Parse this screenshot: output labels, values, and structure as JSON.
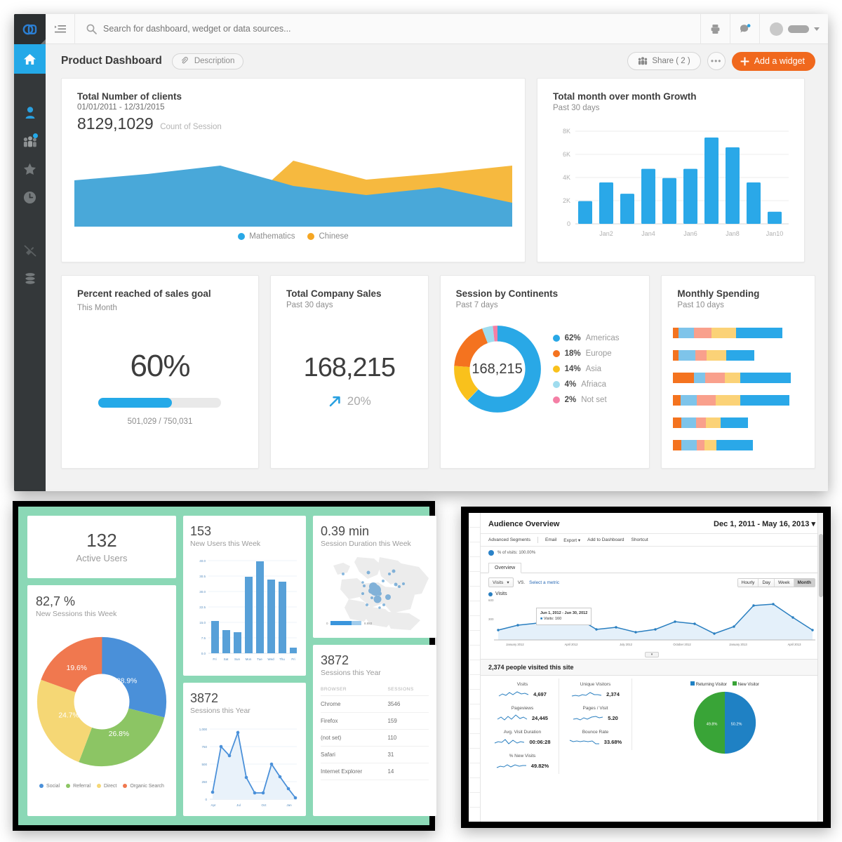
{
  "main_app": {
    "logo_icon": "chain-logo-icon",
    "topbar": {
      "collapse_icon": "collapse-sidebar-icon",
      "search_placeholder": "Search for dashboard, wedget or data sources...",
      "search_value": "",
      "search_icon": "search-icon",
      "print_icon": "print-icon",
      "notifications_icon": "chat-bubble-icon",
      "avatar_icon": "avatar",
      "caret_icon": "chevron-down-icon"
    },
    "sidebar": {
      "items": [
        {
          "name": "home",
          "icon": "home-icon",
          "active": true
        },
        {
          "name": "user",
          "icon": "person-icon",
          "active": false
        },
        {
          "name": "team",
          "icon": "group-icon",
          "active": false,
          "badge": true
        },
        {
          "name": "favorites",
          "icon": "star-icon",
          "active": false
        },
        {
          "name": "recent",
          "icon": "clock-icon",
          "active": false
        },
        {
          "name": "connection",
          "icon": "plug-disconnected-icon",
          "active": false
        },
        {
          "name": "data",
          "icon": "database-icon",
          "active": false
        }
      ]
    },
    "header": {
      "title": "Product Dashboard",
      "description_label": "Description",
      "description_icon": "tag-icon",
      "share_label": "Share ( 2 )",
      "share_icon": "people-icon",
      "more_label": "•••",
      "add_widget_label": "Add a widget",
      "add_widget_icon": "plus-icon",
      "add_widget_color": "#f0681d"
    },
    "widgets": {
      "clients": {
        "title": "Total Number of clients",
        "date_range": "01/01/2011 - 12/31/2015",
        "value": "8129,1029",
        "value_caption": "Count of Session"
      },
      "growth": {
        "title": "Total month over month Growth",
        "subtitle": "Past 30 days"
      },
      "goal": {
        "title": "Percent reached of sales goal",
        "subtitle": "This Month",
        "percent_label": "60%",
        "percent_value": 60,
        "progress_label": "501,029 / 750,031",
        "bar_color": "#24a9e8"
      },
      "sales": {
        "title": "Total Company Sales",
        "subtitle": "Past 30 days",
        "value": "168,215",
        "trend_icon": "arrow-up-right-icon",
        "trend_label": "20%"
      },
      "continents": {
        "title": "Session by Continents",
        "subtitle": "Past 7 days",
        "center_value": "168,215"
      },
      "spending": {
        "title": "Monthly Spending",
        "subtitle": "Past 10 days"
      }
    }
  },
  "green_dashboard": {
    "active_users": {
      "value": "132",
      "label": "Active Users"
    },
    "new_sessions": {
      "value": "82,7 %",
      "label": "New Sessions this Week"
    },
    "new_users": {
      "value": "153",
      "label": "New Users this Week"
    },
    "session_duration": {
      "value": "0.39 min",
      "label": "Session Duration this Week",
      "scale_min": "0",
      "scale_max": "8.883"
    },
    "sessions_line": {
      "value": "3872",
      "label": "Sessions this Year"
    },
    "sessions_table": {
      "value": "3872",
      "label": "Sessions this Year",
      "columns": [
        "BROWSER",
        "SESSIONS"
      ],
      "rows": [
        [
          "Chrome",
          "3546"
        ],
        [
          "Firefox",
          "159"
        ],
        [
          "(not set)",
          "110"
        ],
        [
          "Safari",
          "31"
        ],
        [
          "Internet Explorer",
          "14"
        ]
      ]
    }
  },
  "ga_window": {
    "title": "Audience Overview",
    "date_range": "Dec 1, 2011 - May 16, 2013",
    "date_caret": "▾",
    "toolbar": [
      "Advanced Segments",
      "Email",
      "Export ▾",
      "Add to Dashboard",
      "Shortcut"
    ],
    "segment_label": "% of visits: 100.00%",
    "tab_label": "Overview",
    "metric_select": "Visits",
    "vs_label": "VS.",
    "select_metric_link": "Select a metric",
    "granularity": [
      "Hourly",
      "Day",
      "Week",
      "Month"
    ],
    "granularity_selected": "Month",
    "series_label": "Visits",
    "tooltip": {
      "range": "Jun 1, 2012 - Jun 30, 2012",
      "value": "Visits: 160"
    },
    "people_line": "2,374 people visited this site",
    "metrics": [
      {
        "name": "Visits",
        "value": "4,697"
      },
      {
        "name": "Unique Visitors",
        "value": "2,374"
      },
      {
        "name": "Pageviews",
        "value": "24,445"
      },
      {
        "name": "Pages / Visit",
        "value": "5.20"
      },
      {
        "name": "Avg. Visit Duration",
        "value": "00:06:28"
      },
      {
        "name": "Bounce Rate",
        "value": "33.68%"
      },
      {
        "name": "% New Visits",
        "value": "49.82%"
      }
    ],
    "pie_legend": [
      {
        "label": "Returning Visitor",
        "color": "#1f81c4"
      },
      {
        "label": "New Visitor",
        "color": "#39a437"
      }
    ]
  },
  "chart_data": [
    {
      "type": "area",
      "title": "Total Number of clients",
      "id": "clients-area-chart",
      "categories": [
        "1",
        "2",
        "3",
        "4",
        "5",
        "6",
        "7"
      ],
      "series": [
        {
          "name": "Mathematics",
          "color": "#49a8d9",
          "values": [
            62,
            68,
            76,
            58,
            55,
            60,
            48
          ]
        },
        {
          "name": "Chinese",
          "color": "#f6b93f",
          "values": [
            0,
            0,
            0,
            34,
            28,
            22,
            40
          ]
        }
      ],
      "legend_position": "bottom",
      "grid": false
    },
    {
      "type": "bar",
      "id": "growth-bar-chart",
      "title": "Total month over month Growth",
      "subtitle": "Past 30 days",
      "categories": [
        "Jan1",
        "Jan2",
        "Jan3",
        "Jan4",
        "Jan5",
        "Jan6",
        "Jan7",
        "Jan8",
        "Jan9",
        "Jan10"
      ],
      "tick_labels": [
        "Jan2",
        "Jan4",
        "Jan6",
        "Jan8",
        "Jan10"
      ],
      "values": [
        1750,
        3150,
        2600,
        4750,
        3950,
        4750,
        7450,
        6600,
        3150,
        1050
      ],
      "ytick_labels": [
        "0",
        "2K",
        "4K",
        "6K",
        "8K"
      ],
      "ylim": [
        0,
        8000
      ],
      "color": "#2aa8e8",
      "grid": true
    },
    {
      "type": "pie",
      "id": "continents-donut-chart",
      "title": "Session by Continents",
      "subtitle": "Past 7 days",
      "center_label": "168,215",
      "labels": [
        "Americas",
        "Europe",
        "Asia",
        "Afriaca",
        "Not set"
      ],
      "values": [
        62,
        18,
        14,
        4,
        2
      ],
      "display_values": [
        "62%",
        "18%",
        "14%",
        "4%",
        "2%"
      ],
      "colors": [
        "#29a8e6",
        "#f4731f",
        "#f9c11c",
        "#9fdcee",
        "#f47fa5"
      ],
      "legend_position": "right"
    },
    {
      "type": "bar",
      "id": "monthly-spending-stacked-bars",
      "title": "Monthly Spending",
      "subtitle": "Past 10 days",
      "orientation": "horizontal",
      "stacked": true,
      "colors": [
        "#f4731f",
        "#7ec4ea",
        "#f9a08c",
        "#fbd277",
        "#2aa8e8"
      ],
      "rows": [
        [
          5,
          14,
          16,
          22,
          61
        ],
        [
          5,
          15,
          10,
          18,
          38
        ],
        [
          21,
          11,
          18,
          14,
          67
        ],
        [
          7,
          15,
          17,
          23,
          66
        ],
        [
          8,
          13,
          9,
          14,
          34
        ],
        [
          8,
          14,
          7,
          11,
          42
        ]
      ]
    },
    {
      "type": "bar",
      "id": "new-users-week-bar-chart",
      "title": "New Users this Week",
      "categories": [
        "Fri",
        "Sat",
        "Sun",
        "Mon",
        "Tue",
        "Wed",
        "Thu",
        "Fri"
      ],
      "values": [
        14,
        10,
        9,
        33,
        40,
        32,
        31,
        2
      ],
      "ytick_labels": [
        "0.0",
        "7.5",
        "15.0",
        "22.5",
        "30.0",
        "30.5",
        "40.0"
      ],
      "ylim": [
        0,
        40
      ],
      "color": "#57a0d8"
    },
    {
      "type": "pie",
      "id": "new-sessions-donut-chart",
      "title": "New Sessions this Week",
      "labels": [
        "Social",
        "Referral",
        "Direct",
        "Organic Search"
      ],
      "values": [
        28.9,
        26.8,
        24.7,
        19.6
      ],
      "display_values": [
        "28.9%",
        "26.8%",
        "24.7%",
        "19.6%"
      ],
      "colors": [
        "#4a90d9",
        "#8cc564",
        "#f5d775",
        "#f0784f"
      ],
      "legend_position": "bottom"
    },
    {
      "type": "line",
      "id": "sessions-year-line-chart",
      "title": "Sessions this Year",
      "x": [
        "Apr",
        "",
        "",
        "Jul",
        "",
        "",
        "Oct",
        "",
        "",
        "Jan",
        ""
      ],
      "tick_labels": [
        "Apr",
        "Jul",
        "Oct",
        "Jan"
      ],
      "values": [
        100,
        745,
        620,
        950,
        310,
        90,
        90,
        500,
        320,
        150,
        20
      ],
      "ytick_labels": [
        "0",
        "250",
        "500",
        "750",
        "1,000"
      ],
      "ylim": [
        0,
        1000
      ],
      "color": "#4a90d9"
    },
    {
      "type": "line",
      "id": "ga-visits-line-chart",
      "title": "Visits",
      "tick_labels": [
        "January 2012",
        "April 2012",
        "July 2012",
        "October 2012",
        "January 2013",
        "April 2013"
      ],
      "ytick_labels": [
        "300",
        "600"
      ],
      "ylim": [
        0,
        600
      ],
      "values": [
        150,
        215,
        240,
        330,
        300,
        160,
        185,
        130,
        165,
        255,
        235,
        120,
        190,
        430,
        455,
        320,
        150
      ],
      "color": "#2a7fc0"
    },
    {
      "type": "pie",
      "id": "ga-visitor-type-pie-chart",
      "labels": [
        "Returning Visitor",
        "New Visitor"
      ],
      "values": [
        50.2,
        49.8
      ],
      "display_values": [
        "50.2%",
        "49.8%"
      ],
      "colors": [
        "#1f81c4",
        "#39a437"
      ],
      "legend_position": "top"
    }
  ]
}
